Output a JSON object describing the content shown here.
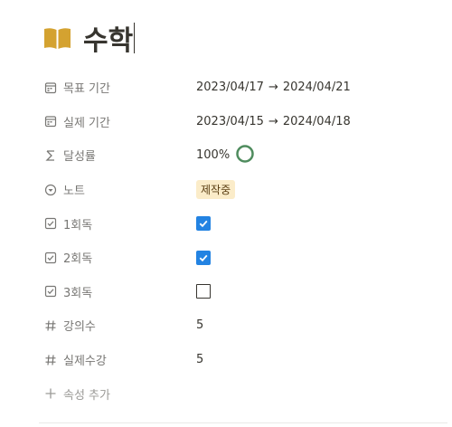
{
  "page": {
    "title": "수학",
    "icon": "open-book-icon",
    "icon_color": "#d4a230"
  },
  "properties": [
    {
      "key": "target_period",
      "name": "목표 기간",
      "icon": "calendar-icon",
      "start": "2023/04/17",
      "arrow": "→",
      "end": "2024/04/21"
    },
    {
      "key": "actual_period",
      "name": "실제 기간",
      "icon": "calendar-icon",
      "start": "2023/04/15",
      "arrow": "→",
      "end": "2024/04/18"
    },
    {
      "key": "achievement",
      "name": "달성률",
      "icon": "sigma-icon",
      "value": "100%",
      "progress": 1.0,
      "ring_color": "#4f8c5e"
    },
    {
      "key": "note",
      "name": "노트",
      "icon": "status-icon",
      "value": "제작중",
      "tag_color": "#fbecc9"
    },
    {
      "key": "read1",
      "name": "1회독",
      "icon": "checkbox-icon",
      "checked": true
    },
    {
      "key": "read2",
      "name": "2회독",
      "icon": "checkbox-icon",
      "checked": true
    },
    {
      "key": "read3",
      "name": "3회독",
      "icon": "checkbox-icon",
      "checked": false
    },
    {
      "key": "lectures",
      "name": "강의수",
      "icon": "hash-icon",
      "value": "5"
    },
    {
      "key": "actual_lectures",
      "name": "실제수강",
      "icon": "hash-icon",
      "value": "5"
    }
  ],
  "add_property": {
    "label": "속성 추가",
    "icon": "plus-icon"
  },
  "colors": {
    "checkbox": "#2383e2",
    "label": "#787774",
    "text": "#37352f"
  }
}
